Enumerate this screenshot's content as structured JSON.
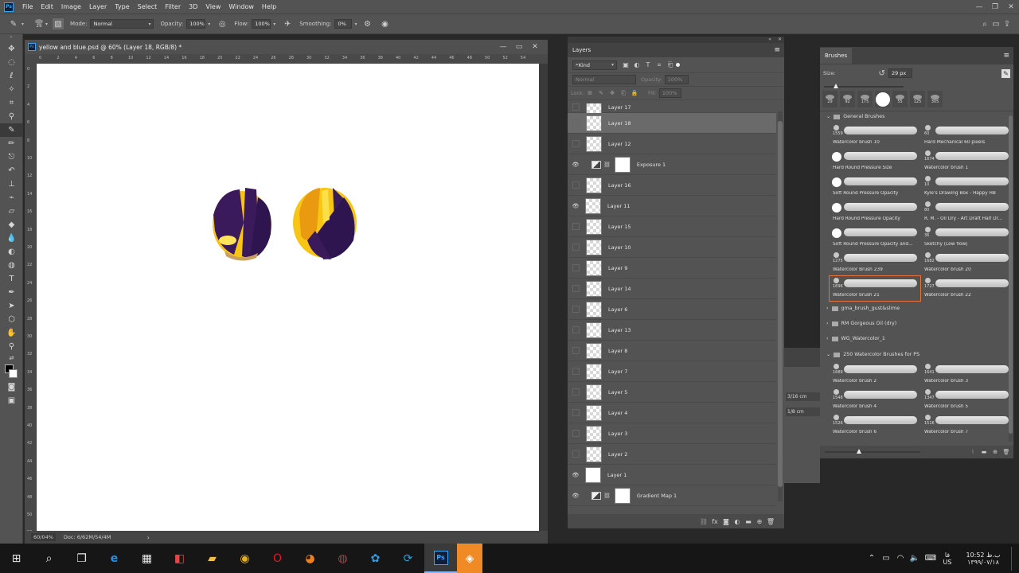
{
  "menubar": {
    "app_icon": "Ps",
    "items": [
      "File",
      "Edit",
      "Image",
      "Layer",
      "Type",
      "Select",
      "Filter",
      "3D",
      "View",
      "Window",
      "Help"
    ]
  },
  "options": {
    "brush_size": "29",
    "mode_label": "Mode:",
    "mode_value": "Normal",
    "opacity_label": "Opacity:",
    "opacity_value": "100%",
    "flow_label": "Flow:",
    "flow_value": "100%",
    "smoothing_label": "Smoothing:",
    "smoothing_value": "0%"
  },
  "document": {
    "title": "yellow and blue.psd @ 60% (Layer 18, RGB/8) *",
    "ruler_h": [
      "0",
      "2",
      "4",
      "6",
      "8",
      "10",
      "12",
      "14",
      "16",
      "18",
      "20",
      "22",
      "24",
      "26",
      "28",
      "30",
      "32",
      "34",
      "36",
      "38",
      "40",
      "42",
      "44",
      "46",
      "48",
      "50",
      "52",
      "54"
    ],
    "ruler_v": [
      "0",
      "2",
      "4",
      "6",
      "8",
      "10",
      "12",
      "14",
      "16",
      "18",
      "20",
      "22",
      "24",
      "26",
      "28",
      "30",
      "32",
      "34",
      "36",
      "38",
      "40",
      "42",
      "44",
      "46",
      "48",
      "50",
      "52"
    ],
    "zoom": "60/04%",
    "doc_info": "Doc: 6/62M/54/4M"
  },
  "layers_panel": {
    "title": "Layers",
    "kind_label": "Kind",
    "blend_mode": "Normal",
    "opacity_label": "Opacity:",
    "opacity_value": "100%",
    "lock_label": "Lock:",
    "fill_label": "Fill:",
    "fill_value": "100%",
    "layers": [
      {
        "name": "Layer 17",
        "visible": false,
        "type": "pixel"
      },
      {
        "name": "Layer 18",
        "visible": false,
        "type": "pixel",
        "selected": true
      },
      {
        "name": "Layer 12",
        "visible": false,
        "type": "pixel"
      },
      {
        "name": "Exposure 1",
        "visible": true,
        "type": "adjustment"
      },
      {
        "name": "Layer 16",
        "visible": false,
        "type": "pixel"
      },
      {
        "name": "Layer 11",
        "visible": true,
        "type": "pixel"
      },
      {
        "name": "Layer 15",
        "visible": false,
        "type": "pixel"
      },
      {
        "name": "Layer 10",
        "visible": false,
        "type": "pixel"
      },
      {
        "name": "Layer 9",
        "visible": false,
        "type": "pixel"
      },
      {
        "name": "Layer 14",
        "visible": false,
        "type": "pixel"
      },
      {
        "name": "Layer 6",
        "visible": false,
        "type": "pixel"
      },
      {
        "name": "Layer 13",
        "visible": false,
        "type": "pixel"
      },
      {
        "name": "Layer 8",
        "visible": false,
        "type": "pixel"
      },
      {
        "name": "Layer 7",
        "visible": false,
        "type": "pixel"
      },
      {
        "name": "Layer 5",
        "visible": false,
        "type": "pixel"
      },
      {
        "name": "Layer 4",
        "visible": false,
        "type": "pixel"
      },
      {
        "name": "Layer 3",
        "visible": false,
        "type": "pixel"
      },
      {
        "name": "Layer 2",
        "visible": false,
        "type": "pixel"
      },
      {
        "name": "Layer 1",
        "visible": true,
        "type": "white"
      },
      {
        "name": "Gradient Map 1",
        "visible": true,
        "type": "adjustment"
      }
    ]
  },
  "hidden_panel": {
    "value_1": "3/16 cm",
    "value_2": "1/8 cm"
  },
  "brushes_panel": {
    "title": "Brushes",
    "size_label": "Size:",
    "size_value": "29 px",
    "recent": [
      "29",
      "92",
      "175",
      "",
      "55",
      "125",
      "305"
    ],
    "groups": {
      "general": "General Brushes",
      "g1": "gma_brush_gust&slime",
      "g2": "RM Gorgeous Oil (dry)",
      "g3": "WG_Watercolor_1",
      "g4": "250 Watercolor Brushes for PS"
    },
    "general_brushes": [
      {
        "num": "1559",
        "name": "Watercolor brush 10"
      },
      {
        "num": "60",
        "name": "Hard Mechanical 60 pixels"
      },
      {
        "num": "",
        "name": "Hard Round Pressure Size"
      },
      {
        "num": "1674",
        "name": "Watercolor brush 1"
      },
      {
        "num": "",
        "name": "Soft Round Pressure Opacity"
      },
      {
        "num": "10",
        "name": "Kyle's Drawing Box - Happy HB"
      },
      {
        "num": "",
        "name": "Hard Round Pressure Opacity"
      },
      {
        "num": "80",
        "name": "R. M. - Oil Dry - Art Draft Half Dr..."
      },
      {
        "num": "",
        "name": "Soft Round Pressure Opacity and..."
      },
      {
        "num": "36",
        "name": "Sketchy (Low flow)"
      },
      {
        "num": "1275",
        "name": "Watercolor Brush 239"
      },
      {
        "num": "1682",
        "name": "Watercolor brush 20"
      },
      {
        "num": "1696",
        "name": "Watercolor brush 21"
      },
      {
        "num": "1727",
        "name": "Watercolor brush 22"
      }
    ],
    "wc_brushes": [
      {
        "num": "1689",
        "name": "Watercolor brush 2"
      },
      {
        "num": "1641",
        "name": "Watercolor brush 3"
      },
      {
        "num": "1548",
        "name": "Watercolor brush 4"
      },
      {
        "num": "1347",
        "name": "Watercolor brush 5"
      },
      {
        "num": "1526",
        "name": "Watercolor brush 6"
      },
      {
        "num": "1516",
        "name": "Watercolor brush 7"
      }
    ]
  },
  "taskbar": {
    "lang": "فا",
    "lang2": "US",
    "time": "10:52 ب.ظ",
    "date": "۱۳۹۹/۰۷/۱۸"
  },
  "colors": {
    "accent_selected_brush": "#e8703a",
    "paint_yellow": "#f7c51a",
    "paint_purple": "#3a1a5a"
  }
}
